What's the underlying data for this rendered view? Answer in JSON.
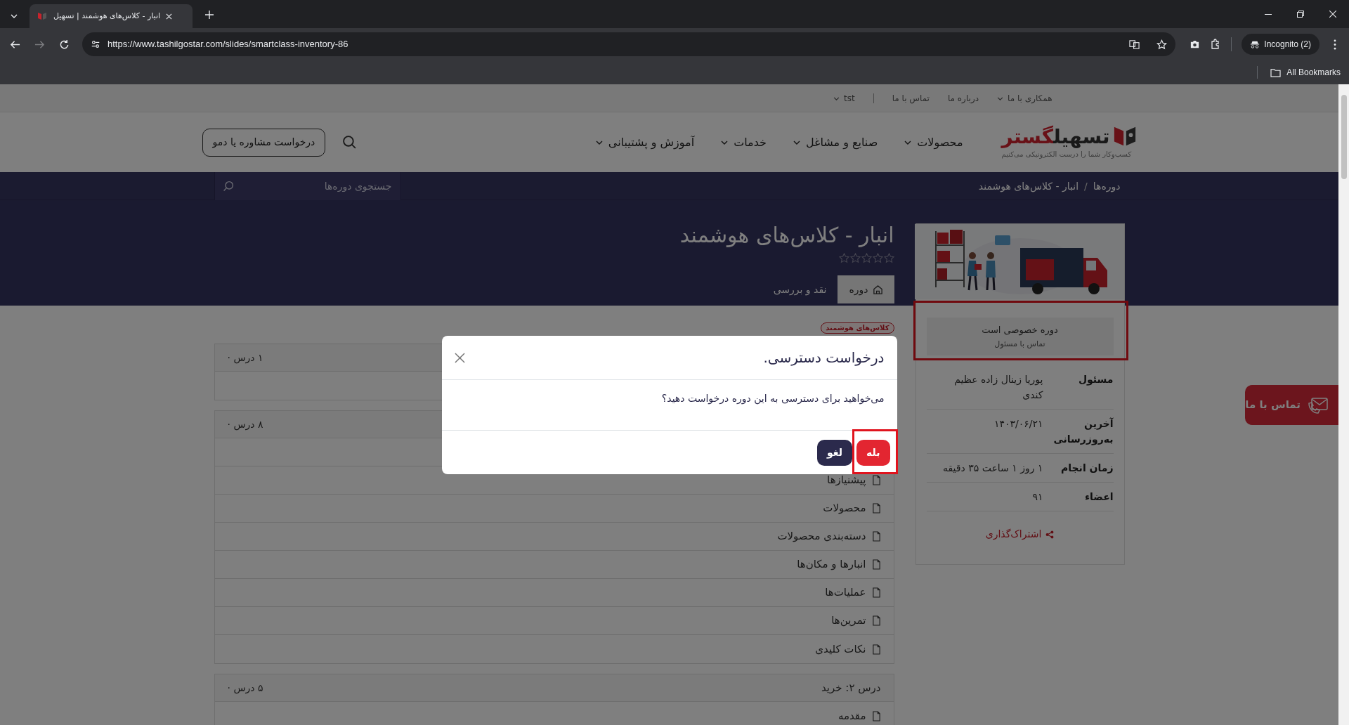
{
  "browser": {
    "tab_title": "انبار - کلاس‌های هوشمند | تسهیل",
    "url": "https://www.tashilgostar.com/slides/smartclass-inventory-86",
    "profile": "Incognito (2)",
    "bookmarks": "All Bookmarks"
  },
  "topbar": [
    {
      "label": "همکاری با ما",
      "dropdown": true
    },
    {
      "label": "درباره ما",
      "dropdown": false
    },
    {
      "label": "تماس با ما",
      "dropdown": false
    },
    {
      "label": "tst",
      "dropdown": true
    }
  ],
  "logo": {
    "first": "تسهیل",
    "second": "گستر",
    "tagline": "کسب‌وکار شما را درست الکترونیکی می‌کنیم"
  },
  "nav": [
    {
      "label": "محصولات",
      "dropdown": true
    },
    {
      "label": "صنایع و مشاغل",
      "dropdown": true
    },
    {
      "label": "خدمات",
      "dropdown": true
    },
    {
      "label": "آموزش و پشتیبانی",
      "dropdown": true
    }
  ],
  "cta": "درخواست مشاوره یا دمو",
  "breadcrumb": {
    "separator": "/",
    "items": [
      "دوره‌ها",
      "انبار - کلاس‌های هوشمند"
    ]
  },
  "course_search": {
    "placeholder": "جستجوی دوره‌ها"
  },
  "course": {
    "title": "انبار - کلاس‌های هوشمند",
    "stars": 0,
    "tabs": [
      {
        "label": "دوره",
        "selected": true
      },
      {
        "label": "نقد و بررسی",
        "selected": false
      }
    ],
    "tag": "کلاس‌های هوشمند",
    "sections": [
      {
        "count": "۱ درس ·",
        "lessons": [
          {
            "kind": "covered"
          }
        ]
      },
      {
        "count": "۸ درس ·",
        "lessons": [
          {
            "kind": "covered"
          },
          {
            "kind": "lesson",
            "label": "پیشنیازها"
          },
          {
            "kind": "lesson",
            "label": "محصولات"
          },
          {
            "kind": "lesson",
            "label": "دسته‌بندی محصولات"
          },
          {
            "kind": "lesson",
            "label": "انبارها و مکان‌ها"
          },
          {
            "kind": "lesson",
            "label": "عملیات‌ها"
          },
          {
            "kind": "lesson",
            "label": "تمرین‌ها"
          },
          {
            "kind": "lesson",
            "label": "نکات کلیدی"
          }
        ]
      },
      {
        "title": "درس ۲: خرید",
        "count": "۵ درس ·",
        "lessons": [
          {
            "kind": "lesson",
            "label": "مقدمه"
          }
        ]
      }
    ]
  },
  "sidebar": {
    "private": {
      "title": "دوره خصوصی است",
      "link": "تماس با مسئول",
      "highlighted": true
    },
    "info": [
      {
        "label": "مسئول",
        "value": "پوریا زینال زاده عظیم کندی"
      },
      {
        "label": "آخرین به‌روزرسانی",
        "value": "۱۴۰۳/۰۶/۲۱"
      },
      {
        "label": "زمان انجام",
        "value": "۱ روز ۱ ساعت ۳۵ دقیقه"
      },
      {
        "label": "اعضاء",
        "value": "۹۱"
      }
    ],
    "share": "اشتراک‌گذاری"
  },
  "contact_button": "تماس با ما",
  "modal": {
    "title": "درخواست دسترسی.",
    "message": "می‌خواهید برای دسترسی به این دوره درخواست دهید؟",
    "buttons": [
      {
        "label": "بله",
        "kind": "primary",
        "highlighted": true
      },
      {
        "label": "لغو",
        "kind": "secondary",
        "highlighted": false
      }
    ]
  }
}
